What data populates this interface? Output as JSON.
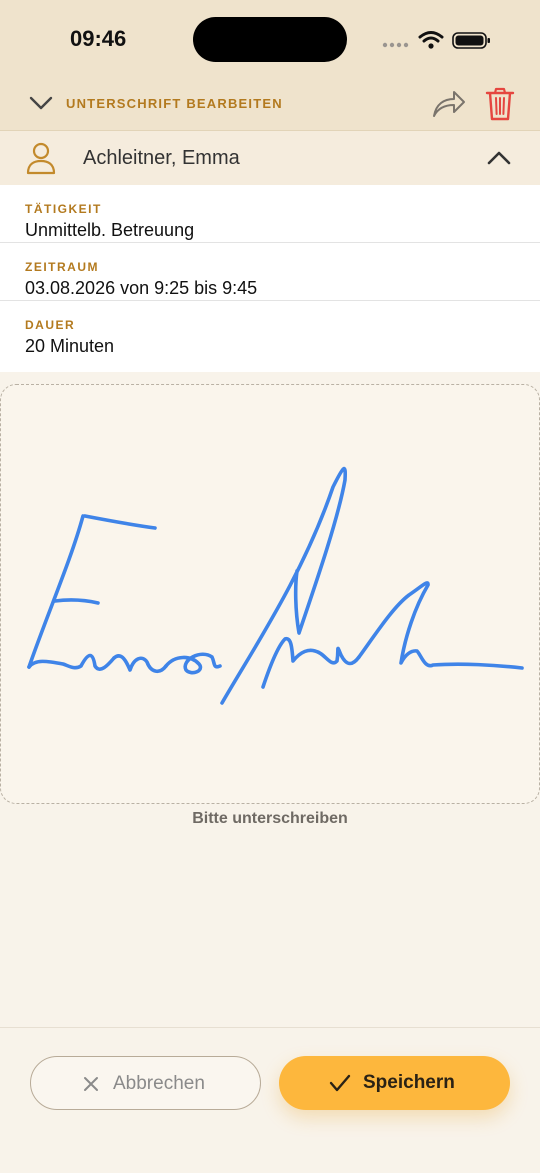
{
  "status_bar": {
    "time": "09:46"
  },
  "header": {
    "title": "UNTERSCHRIFT BEARBEITEN"
  },
  "person": {
    "name": "Achleitner, Emma"
  },
  "info": [
    {
      "label": "TÄTIGKEIT",
      "value": "Unmittelb. Betreuung"
    },
    {
      "label": "ZEITRAUM",
      "value": "03.08.2026 von 9:25 bis 9:45"
    },
    {
      "label": "DAUER",
      "value": "20 Minuten"
    }
  ],
  "signature": {
    "hint": "Bitte unterschreiben",
    "stroke_color": "#3f84e8"
  },
  "actions": {
    "cancel_label": "Abbrechen",
    "save_label": "Speichern"
  },
  "colors": {
    "accent": "#b37a1f",
    "save_bg": "#fdb73d",
    "delete": "#e5463f",
    "header_bg": "#efe3cc"
  },
  "icons": [
    "chevron-down-icon",
    "share-icon",
    "trash-icon",
    "person-icon",
    "chevron-up-icon",
    "close-icon",
    "checkmark-icon"
  ]
}
